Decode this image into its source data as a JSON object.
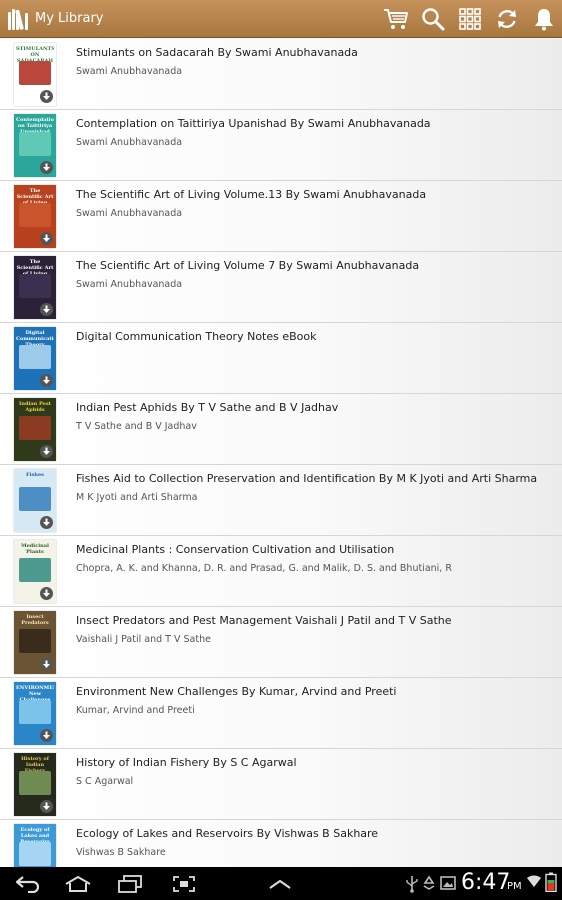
{
  "app": {
    "title": "My Library",
    "accent": "#b5844c"
  },
  "toolbar": {
    "icons": [
      "cart-icon",
      "search-icon",
      "grid-view-icon",
      "refresh-icon",
      "notification-bell-icon"
    ]
  },
  "books": [
    {
      "title": "Stimulants on Sadacarah By Swami Anubhavanada",
      "author": "Swami Anubhavanada",
      "cover_text": "STIMULANTS ON SADACARAH",
      "cover_bg": "#ffffff",
      "cover_fg": "#2a7a3a",
      "cover_art": "#b9473b"
    },
    {
      "title": "Contemplation on Taittiriya Upanishad By Swami Anubhavanada",
      "author": "Swami Anubhavanada",
      "cover_text": "Contemplation on Taittiriya Upanishad",
      "cover_bg": "#2aa69a",
      "cover_fg": "#ffffff",
      "cover_art": "#5fc9b5"
    },
    {
      "title": "The Scientific Art of Living Volume.13 By Swami Anubhavanada",
      "author": "Swami Anubhavanada",
      "cover_text": "The Scientific Art of Living",
      "cover_bg": "#b8421e",
      "cover_fg": "#ffffff",
      "cover_art": "#c9552c"
    },
    {
      "title": "The Scientific Art of Living Volume 7 By Swami Anubhavanada",
      "author": "Swami Anubhavanada",
      "cover_text": "The Scientific Art of Living",
      "cover_bg": "#2b2238",
      "cover_fg": "#ffffff",
      "cover_art": "#3c3050"
    },
    {
      "title": "Digital Communication Theory Notes eBook",
      "author": "",
      "cover_text": "Digital Communication Theory",
      "cover_bg": "#1e73b8",
      "cover_fg": "#ffffff",
      "cover_art": "#9ccae8"
    },
    {
      "title": "Indian Pest Aphids By T V Sathe and B V Jadhav",
      "author": "T V Sathe and B V Jadhav",
      "cover_text": "Indian Pest Aphids",
      "cover_bg": "#2f3a1a",
      "cover_fg": "#f2d23a",
      "cover_art": "#8b3b22"
    },
    {
      "title": "Fishes Aid to Collection Preservation and Identification By M K Jyoti and Arti Sharma",
      "author": "M K Jyoti and Arti Sharma",
      "cover_text": "Fishes",
      "cover_bg": "#d7e9f5",
      "cover_fg": "#1d5fa8",
      "cover_art": "#4d8fc4"
    },
    {
      "title": "Medicinal Plants : Conservation Cultivation and Utilisation",
      "author": "Chopra, A. K. and Khanna, D. R. and Prasad, G. and Malik, D. S. and Bhutiani, R",
      "cover_text": "Medicinal Plants",
      "cover_bg": "#f3f3e8",
      "cover_fg": "#2e5a2e",
      "cover_art": "#4f9a8f"
    },
    {
      "title": "Insect Predators and Pest Management Vaishali J Patil and T V Sathe",
      "author": "Vaishali J Patil and T V Sathe",
      "cover_text": "Insect Predators",
      "cover_bg": "#6b5433",
      "cover_fg": "#f7e6b5",
      "cover_art": "#3a2c1c"
    },
    {
      "title": "Environment New Challenges By Kumar, Arvind and Preeti",
      "author": "Kumar, Arvind and Preeti",
      "cover_text": "ENVIRONMENT New Challenges",
      "cover_bg": "#2a86c8",
      "cover_fg": "#ffffff",
      "cover_art": "#7cc3ea"
    },
    {
      "title": "History of Indian Fishery By S C Agarwal",
      "author": "S C Agarwal",
      "cover_text": "History of Indian Fishery",
      "cover_bg": "#262a1c",
      "cover_fg": "#e8c85a",
      "cover_art": "#6f8a52"
    },
    {
      "title": "Ecology of Lakes and Reservoirs By Vishwas B Sakhare",
      "author": "Vishwas B Sakhare",
      "cover_text": "Ecology of Lakes and Reservoirs",
      "cover_bg": "#3d9ad6",
      "cover_fg": "#ffffff",
      "cover_art": "#a5d5f2"
    }
  ],
  "system_bar": {
    "time": "6:47",
    "ampm": "PM",
    "icons": [
      "back-icon",
      "home-icon",
      "recent-apps-icon",
      "screenshot-icon",
      "menu-up-icon",
      "usb-icon",
      "recycle-icon",
      "gallery-icon",
      "wifi-icon",
      "battery-icon"
    ]
  }
}
